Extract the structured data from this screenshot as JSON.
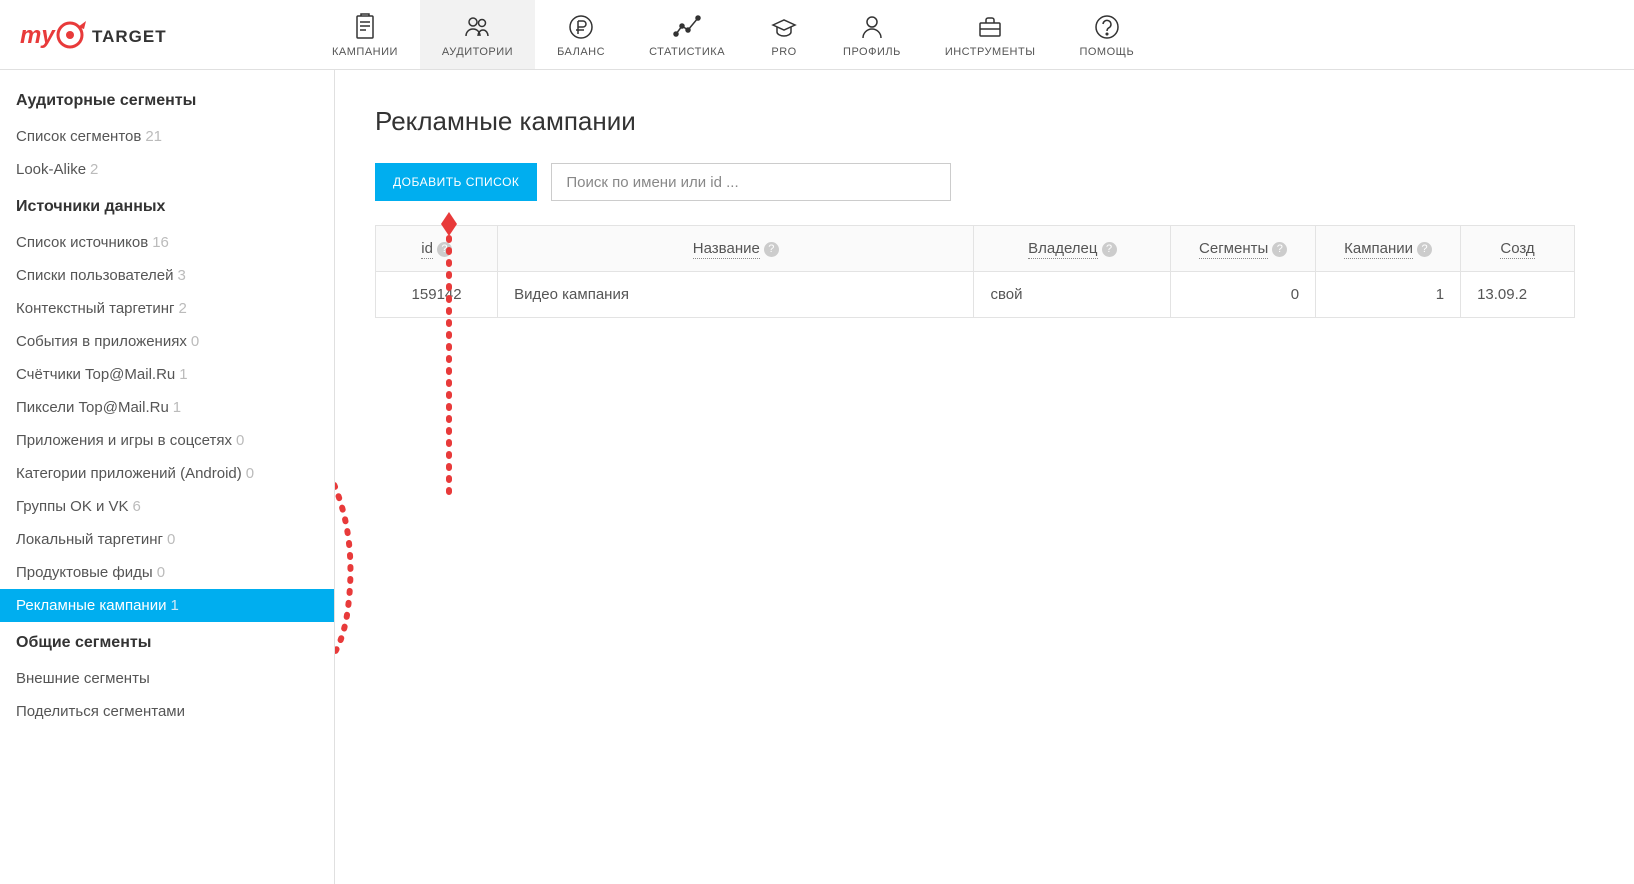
{
  "nav": {
    "items": [
      {
        "label": "КАМПАНИИ"
      },
      {
        "label": "АУДИТОРИИ"
      },
      {
        "label": "БАЛАНС"
      },
      {
        "label": "СТАТИСТИКА"
      },
      {
        "label": "PRO"
      },
      {
        "label": "ПРОФИЛЬ"
      },
      {
        "label": "ИНСТРУМЕНТЫ"
      },
      {
        "label": "ПОМОЩЬ"
      }
    ]
  },
  "sidebar": {
    "section1_title": "Аудиторные сегменты",
    "section1": [
      {
        "label": "Список сегментов",
        "count": "21"
      },
      {
        "label": "Look-Alike",
        "count": "2"
      }
    ],
    "section2_title": "Источники данных",
    "section2": [
      {
        "label": "Список источников",
        "count": "16"
      },
      {
        "label": "Списки пользователей",
        "count": "3"
      },
      {
        "label": "Контекстный таргетинг",
        "count": "2"
      },
      {
        "label": "События в приложениях",
        "count": "0"
      },
      {
        "label": "Счётчики Top@Mail.Ru",
        "count": "1"
      },
      {
        "label": "Пиксели Top@Mail.Ru",
        "count": "1"
      },
      {
        "label": "Приложения и игры в соцсетях",
        "count": "0"
      },
      {
        "label": "Категории приложений (Android)",
        "count": "0"
      },
      {
        "label": "Группы OK и VK",
        "count": "6"
      },
      {
        "label": "Локальный таргетинг",
        "count": "0"
      },
      {
        "label": "Продуктовые фиды",
        "count": "0"
      },
      {
        "label": "Рекламные кампании",
        "count": "1"
      }
    ],
    "section3_title": "Общие сегменты",
    "section3": [
      {
        "label": "Внешние сегменты",
        "count": ""
      },
      {
        "label": "Поделиться сегментами",
        "count": ""
      }
    ]
  },
  "main": {
    "title": "Рекламные кампании",
    "add_button": "ДОБАВИТЬ СПИСОК",
    "search_placeholder": "Поиск по имени или id ...",
    "columns": {
      "id": "id",
      "name": "Название",
      "owner": "Владелец",
      "segments": "Сегменты",
      "campaigns": "Кампании",
      "created": "Созд"
    },
    "rows": [
      {
        "id": "159142",
        "name": "Видео кампания",
        "owner": "свой",
        "segments": "0",
        "campaigns": "1",
        "created": "13.09.2"
      }
    ]
  }
}
